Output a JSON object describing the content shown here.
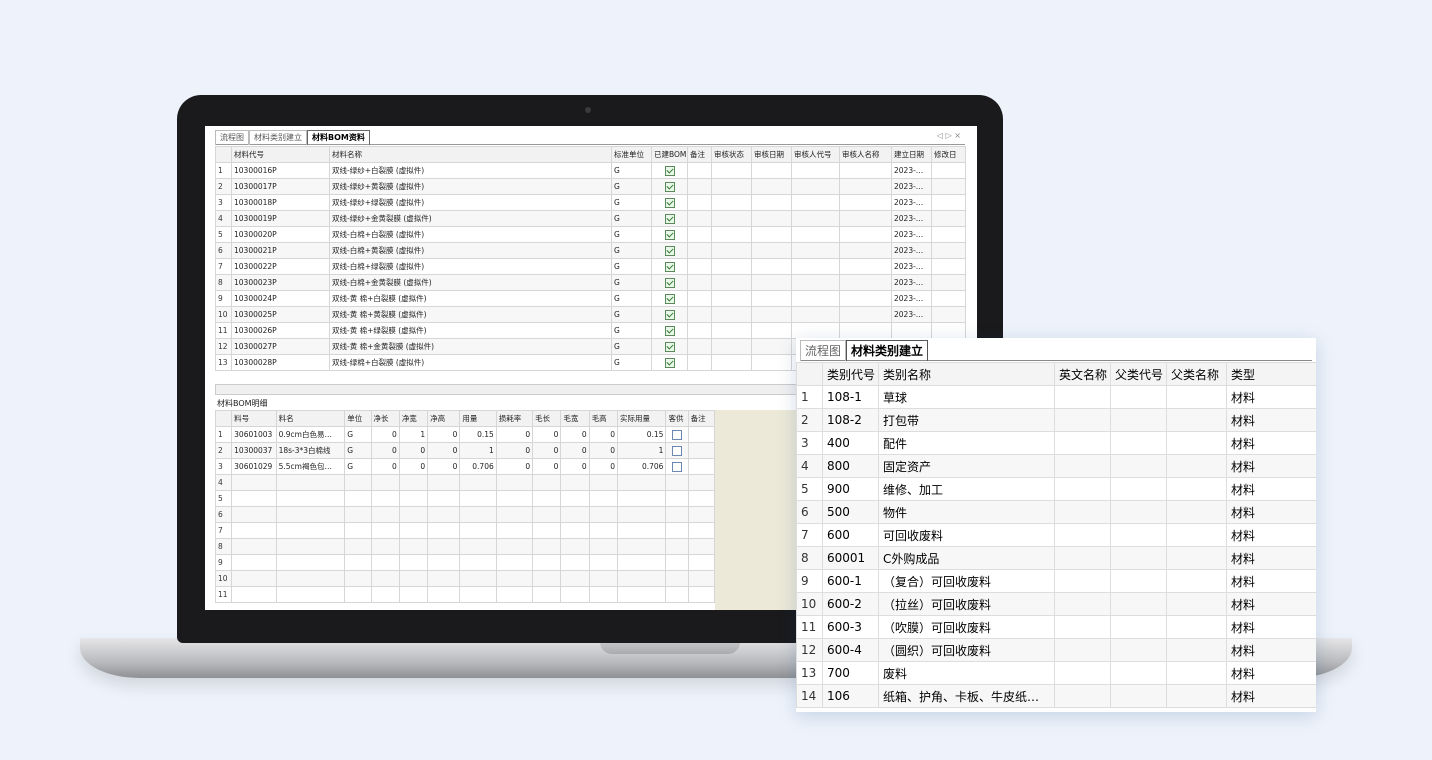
{
  "main_window": {
    "tabs": [
      "流程图",
      "材料类别建立",
      "材料BOM资料"
    ],
    "active_tab": 2,
    "tab_controls": "◁ ▷ ×",
    "bom_table": {
      "headers": [
        "",
        "材料代号",
        "材料名称",
        "标准单位",
        "已建BOM",
        "备注",
        "审核状态",
        "审核日期",
        "审核人代号",
        "审核人名称",
        "建立日期",
        "修改日"
      ],
      "rows": [
        {
          "n": "1",
          "code": "10300016P",
          "name": "双线-绿纱+白裂膜 (虚拟件)",
          "unit": "G",
          "built": true,
          "date": "2023-…"
        },
        {
          "n": "2",
          "code": "10300017P",
          "name": "双线-绿纱+黄裂膜 (虚拟件)",
          "unit": "G",
          "built": true,
          "date": "2023-…"
        },
        {
          "n": "3",
          "code": "10300018P",
          "name": "双线-绿纱+绿裂膜 (虚拟件)",
          "unit": "G",
          "built": true,
          "date": "2023-…"
        },
        {
          "n": "4",
          "code": "10300019P",
          "name": "双线-绿纱+金黄裂膜 (虚拟件)",
          "unit": "G",
          "built": true,
          "date": "2023-…"
        },
        {
          "n": "5",
          "code": "10300020P",
          "name": "双线-白棉+白裂膜 (虚拟件)",
          "unit": "G",
          "built": true,
          "date": "2023-…"
        },
        {
          "n": "6",
          "code": "10300021P",
          "name": "双线-白棉+黄裂膜 (虚拟件)",
          "unit": "G",
          "built": true,
          "date": "2023-…"
        },
        {
          "n": "7",
          "code": "10300022P",
          "name": "双线-白棉+绿裂膜 (虚拟件)",
          "unit": "G",
          "built": true,
          "date": "2023-…"
        },
        {
          "n": "8",
          "code": "10300023P",
          "name": "双线-白棉+金黄裂膜 (虚拟件)",
          "unit": "G",
          "built": true,
          "date": "2023-…"
        },
        {
          "n": "9",
          "code": "10300024P",
          "name": "双线-黄 棉+白裂膜 (虚拟件)",
          "unit": "G",
          "built": true,
          "date": "2023-…"
        },
        {
          "n": "10",
          "code": "10300025P",
          "name": "双线-黄 棉+黄裂膜 (虚拟件)",
          "unit": "G",
          "built": true,
          "date": "2023-…"
        },
        {
          "n": "11",
          "code": "10300026P",
          "name": "双线-黄 棉+绿裂膜 (虚拟件)",
          "unit": "G",
          "built": true,
          "date": ""
        },
        {
          "n": "12",
          "code": "10300027P",
          "name": "双线-黄 棉+金黄裂膜 (虚拟件)",
          "unit": "G",
          "built": true,
          "date": ""
        },
        {
          "n": "13",
          "code": "10300028P",
          "name": "双线-绿棉+白裂膜 (虚拟件)",
          "unit": "G",
          "built": true,
          "date": ""
        }
      ]
    },
    "detail_title": "材料BOM明细",
    "detail_table": {
      "headers": [
        "",
        "料号",
        "料名",
        "单位",
        "净长",
        "净宽",
        "净高",
        "用量",
        "损耗率",
        "毛长",
        "毛宽",
        "毛高",
        "实际用量",
        "客供",
        "备注"
      ],
      "rows": [
        {
          "n": "1",
          "code": "30601003",
          "name": "0.9cm白色易…",
          "unit": "G",
          "a": "0",
          "b": "1",
          "c": "0",
          "qty": "0.15",
          "loss": "0",
          "d": "0",
          "e": "0",
          "f": "0",
          "real": "0.15"
        },
        {
          "n": "2",
          "code": "10300037",
          "name": "18s-3*3白棉线",
          "unit": "G",
          "a": "0",
          "b": "0",
          "c": "0",
          "qty": "1",
          "loss": "0",
          "d": "0",
          "e": "0",
          "f": "0",
          "real": "1"
        },
        {
          "n": "3",
          "code": "30601029",
          "name": "5.5cm褐色包…",
          "unit": "G",
          "a": "0",
          "b": "0",
          "c": "0",
          "qty": "0.706",
          "loss": "0",
          "d": "0",
          "e": "0",
          "f": "0",
          "real": "0.706"
        }
      ],
      "empty_rows": [
        "4",
        "5",
        "6",
        "7",
        "8",
        "9",
        "10",
        "11"
      ]
    }
  },
  "popup_window": {
    "tabs": [
      "流程图",
      "材料类别建立"
    ],
    "active_tab": 1,
    "headers": [
      "",
      "类别代号",
      "类别名称",
      "英文名称",
      "父类代号",
      "父类名称",
      "类型"
    ],
    "rows": [
      {
        "n": "1",
        "code": "108-1",
        "name": "草球",
        "type": "材料"
      },
      {
        "n": "2",
        "code": "108-2",
        "name": "打包带",
        "type": "材料"
      },
      {
        "n": "3",
        "code": "400",
        "name": "配件",
        "type": "材料"
      },
      {
        "n": "4",
        "code": "800",
        "name": "固定资产",
        "type": "材料"
      },
      {
        "n": "5",
        "code": "900",
        "name": "维修、加工",
        "type": "材料"
      },
      {
        "n": "6",
        "code": "500",
        "name": "物件",
        "type": "材料"
      },
      {
        "n": "7",
        "code": "600",
        "name": "可回收废料",
        "type": "材料"
      },
      {
        "n": "8",
        "code": "60001",
        "name": "C外购成品",
        "type": "材料"
      },
      {
        "n": "9",
        "code": "600-1",
        "name": "（复合）可回收废料",
        "type": "材料"
      },
      {
        "n": "10",
        "code": "600-2",
        "name": "（拉丝）可回收废料",
        "type": "材料"
      },
      {
        "n": "11",
        "code": "600-3",
        "name": "（吹膜）可回收废料",
        "type": "材料"
      },
      {
        "n": "12",
        "code": "600-4",
        "name": "（圆织）可回收废料",
        "type": "材料"
      },
      {
        "n": "13",
        "code": "700",
        "name": "废料",
        "type": "材料"
      },
      {
        "n": "14",
        "code": "106",
        "name": "纸箱、护角、卡板、牛皮纸…",
        "type": "材料"
      }
    ]
  }
}
